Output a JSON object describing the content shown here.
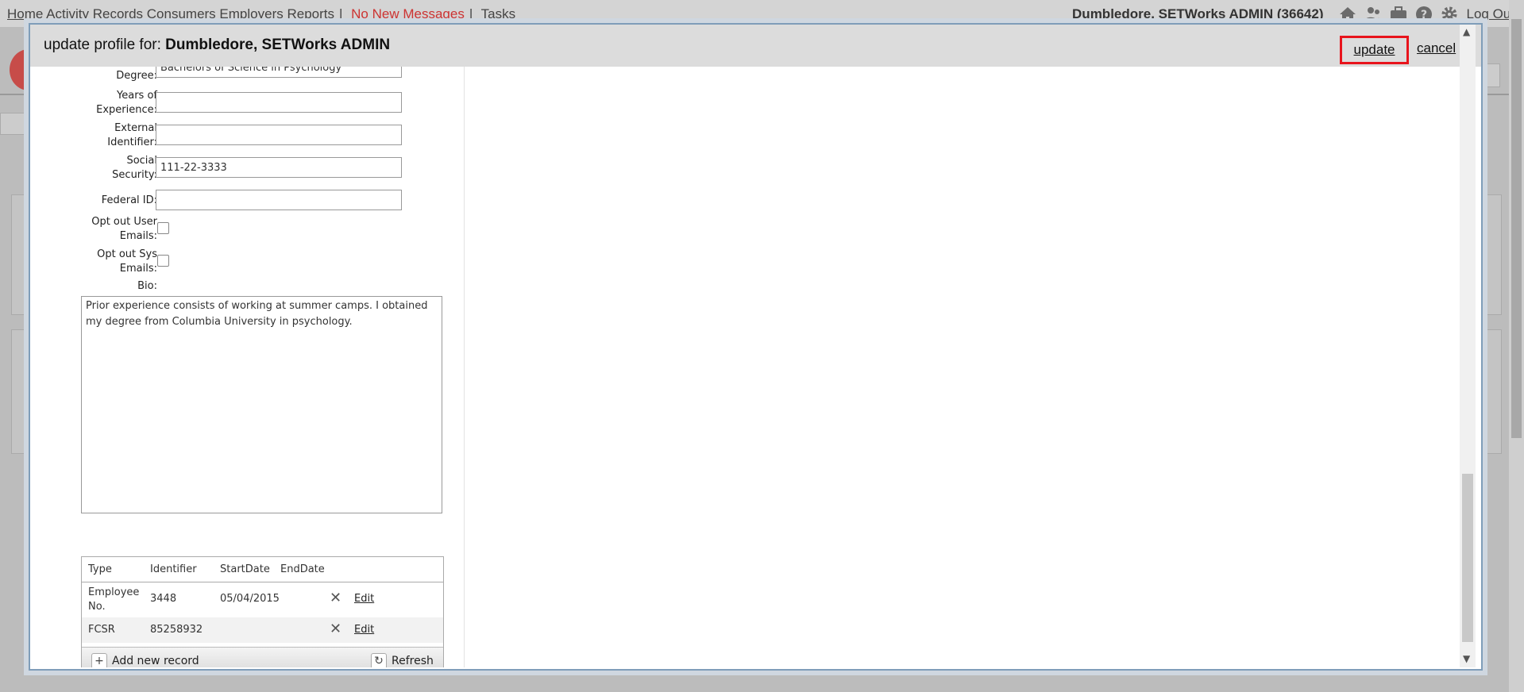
{
  "topnav": {
    "links": [
      "Home",
      "Activity Records",
      "Consumers",
      "Employers",
      "Reports"
    ],
    "messages": "No New Messages",
    "tasks": "Tasks",
    "user": "Dumbledore, SETWorks ADMIN  (36642)",
    "logout": "Log Out",
    "icons": [
      "home-icon",
      "users-icon",
      "briefcase-icon",
      "help-icon",
      "gear-icon"
    ]
  },
  "modal": {
    "title_prefix": "update profile for: ",
    "title_name": "Dumbledore, SETWorks ADMIN",
    "update_label": "update",
    "cancel_label": "cancel"
  },
  "form": {
    "degree_label": "Degree:",
    "degree_value": "Bachelors of Science in Psychology",
    "years_label_1": "Years of",
    "years_label_2": "Experience:",
    "years_value": "",
    "external_label_1": "External",
    "external_label_2": "Identifier:",
    "external_value": "",
    "social_label_1": "Social",
    "social_label_2": "Security:",
    "social_value": "111-22-3333",
    "federal_label": "Federal ID:",
    "federal_value": "",
    "opt_user_label_1": "Opt out User",
    "opt_user_label_2": "Emails:",
    "opt_user_checked": false,
    "opt_sys_label_1": "Opt out Sys",
    "opt_sys_label_2": "Emails:",
    "opt_sys_checked": false,
    "bio_label": "Bio:",
    "bio_value": "Prior experience consists of working at summer camps. I obtained my degree from Columbia University in psychology."
  },
  "records": {
    "columns": [
      "Type",
      "Identifier",
      "StartDate",
      "EndDate"
    ],
    "rows": [
      {
        "type_1": "Employee",
        "type_2": "No.",
        "identifier": "3448",
        "start": "05/04/2015",
        "end": "",
        "edit": "Edit"
      },
      {
        "type_1": "FCSR",
        "type_2": "",
        "identifier": "85258932",
        "start": "",
        "end": "",
        "edit": "Edit"
      }
    ],
    "add_label": "Add new record",
    "refresh_label": "Refresh"
  }
}
